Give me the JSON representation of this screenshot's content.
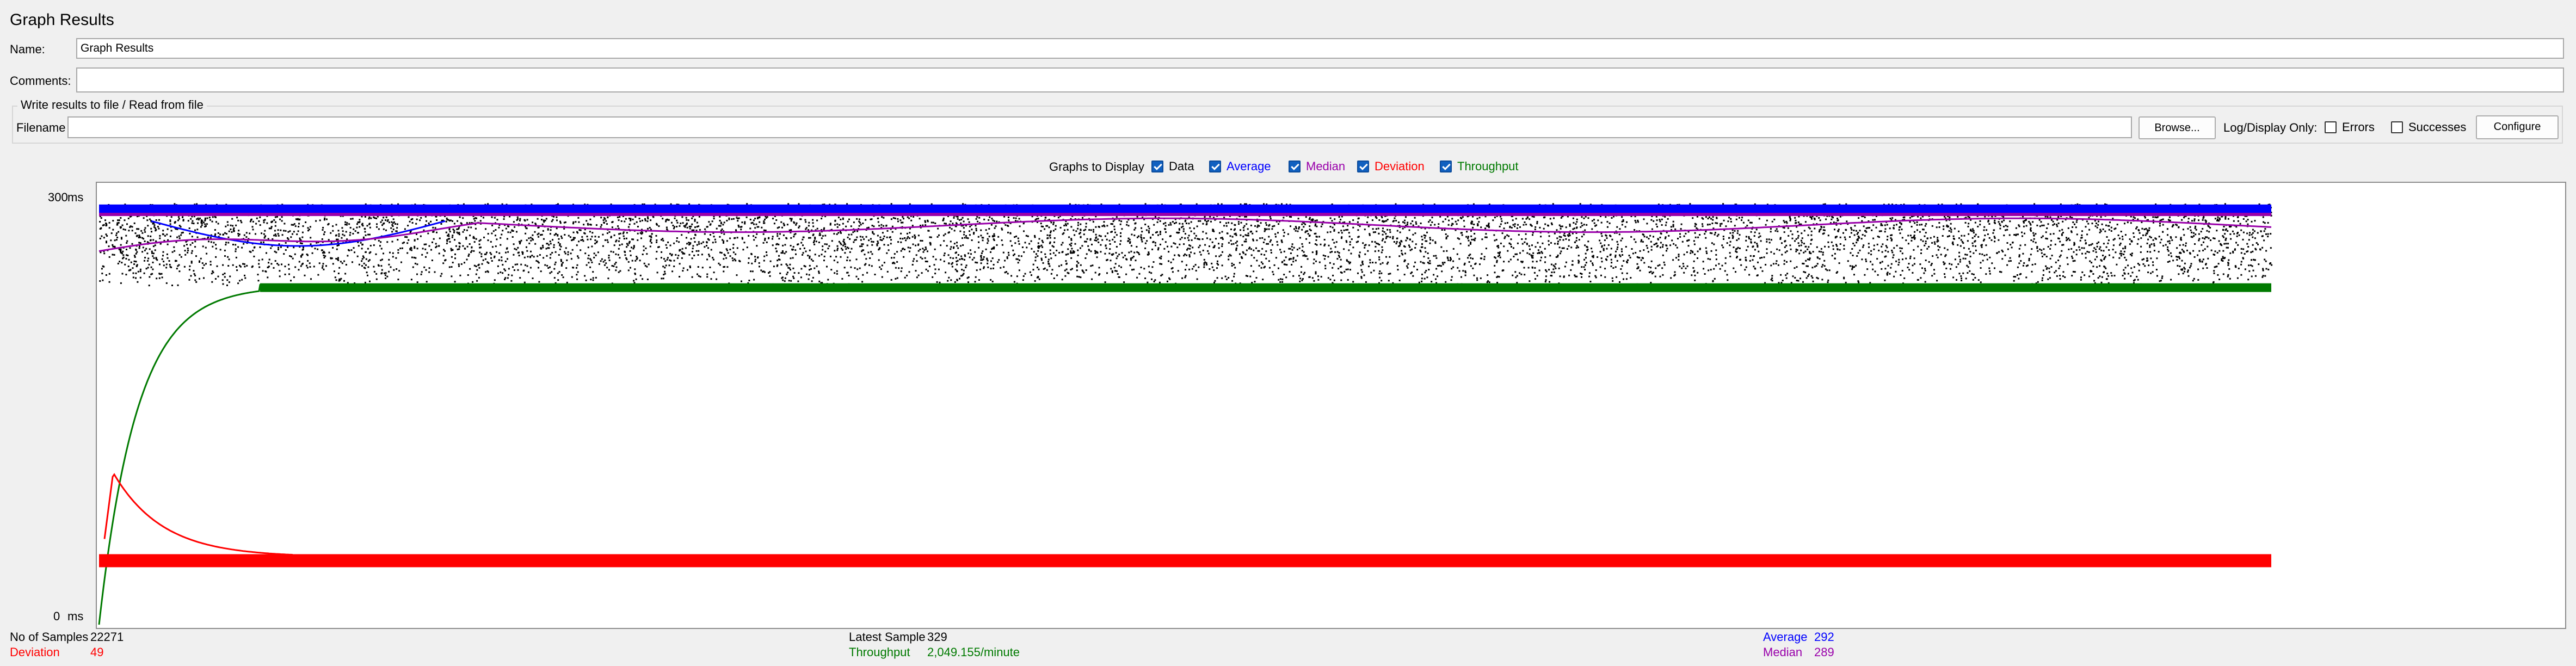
{
  "page": {
    "title": "Graph Results"
  },
  "name_field": {
    "label": "Name:",
    "value": "Graph Results"
  },
  "comments_field": {
    "label": "Comments:",
    "value": ""
  },
  "file_group": {
    "title": "Write results to file / Read from file",
    "filename_label": "Filename",
    "filename_value": "",
    "browse_label": "Browse...",
    "log_display_label": "Log/Display Only:",
    "errors_label": "Errors",
    "errors_checked": false,
    "successes_label": "Successes",
    "successes_checked": false,
    "configure_label": "Configure"
  },
  "graphs_to_display": {
    "label": "Graphs to Display",
    "options": [
      {
        "label": "Data",
        "checked": true,
        "color": "#000000"
      },
      {
        "label": "Average",
        "checked": true,
        "color": "#0000ff"
      },
      {
        "label": "Median",
        "checked": true,
        "color": "#9900aa"
      },
      {
        "label": "Deviation",
        "checked": true,
        "color": "#ff0000"
      },
      {
        "label": "Throughput",
        "checked": true,
        "color": "#007a00"
      }
    ]
  },
  "chart_data": {
    "type": "scatter",
    "y_unit": "ms",
    "y_max_label": "300",
    "y_min_label": "0",
    "ylim": [
      0,
      300
    ],
    "x_sample_count": 22271,
    "series": [
      {
        "name": "Data",
        "color": "#000000",
        "band": [
          245,
          305
        ]
      },
      {
        "name": "Average",
        "color": "#0000ff",
        "final": 292
      },
      {
        "name": "Median",
        "color": "#9900aa",
        "final": 289
      },
      {
        "name": "Deviation",
        "color": "#ff0000",
        "final": 49,
        "peak": 110
      },
      {
        "name": "Throughput",
        "color": "#007a00",
        "plateau": 245
      }
    ]
  },
  "stats": {
    "samples_label": "No of Samples",
    "samples_value": "22271",
    "deviation_label": "Deviation",
    "deviation_value": "49",
    "latest_label": "Latest Sample",
    "latest_value": "329",
    "throughput_label": "Throughput",
    "throughput_value": "2,049.155/minute",
    "average_label": "Average",
    "average_value": "292",
    "median_label": "Median",
    "median_value": "289"
  },
  "colors": {
    "data": "#000000",
    "average": "#0000ff",
    "median": "#9900aa",
    "deviation": "#ff0000",
    "throughput": "#007a00"
  }
}
